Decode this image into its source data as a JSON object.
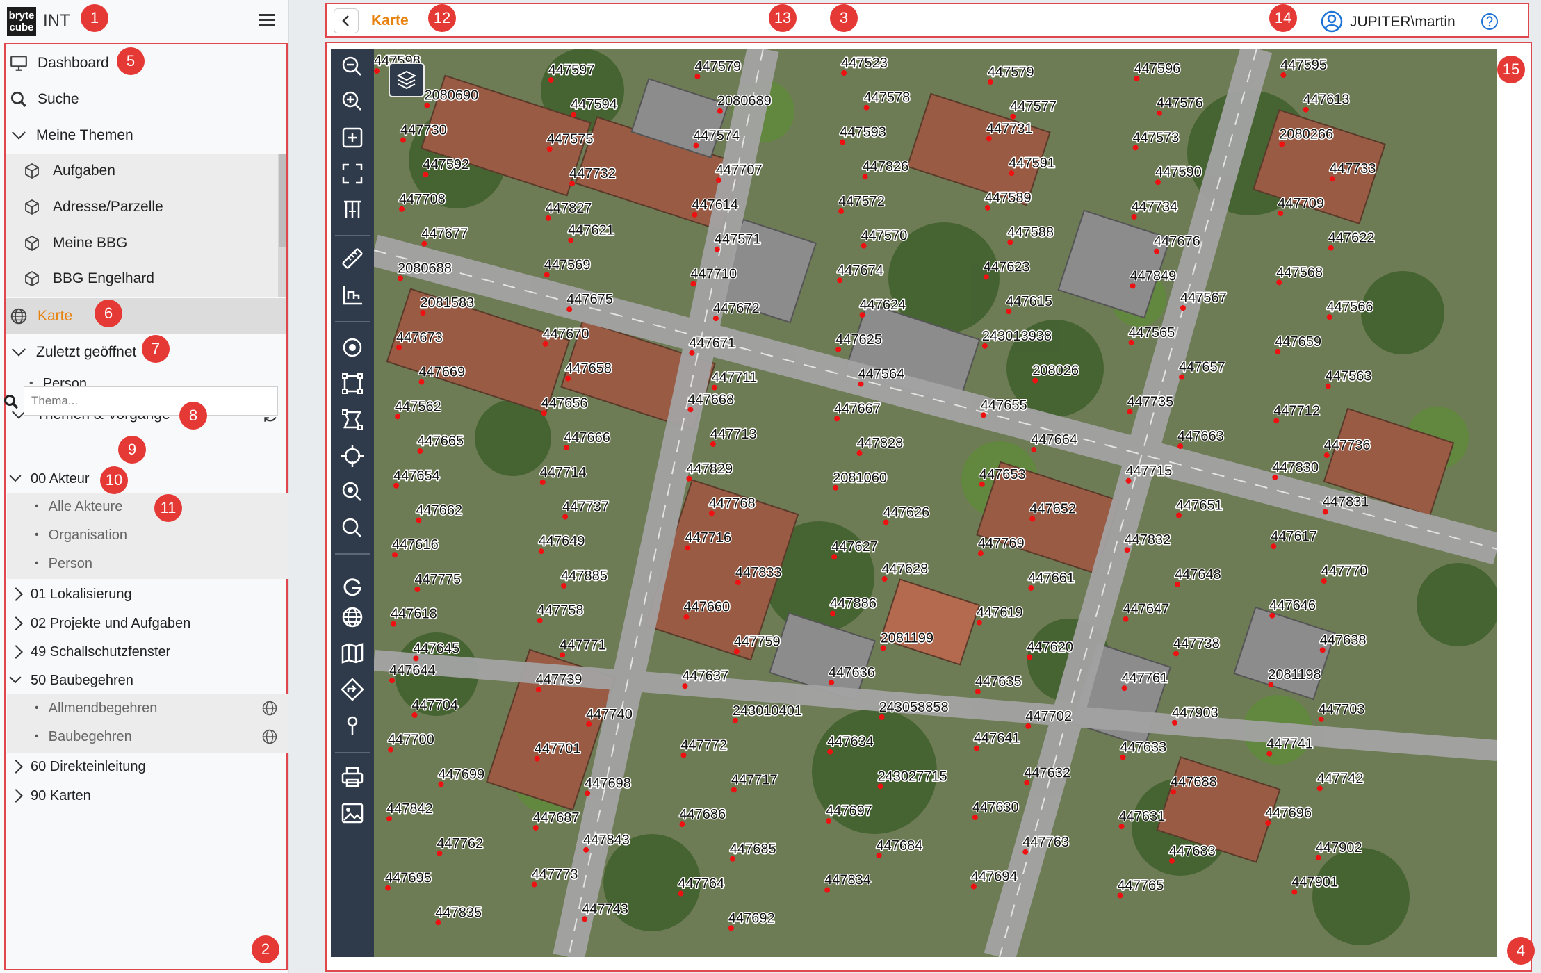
{
  "app": {
    "name": "INT",
    "logo_text": [
      "bryte",
      "cube"
    ]
  },
  "sidebar": {
    "dashboard": "Dashboard",
    "search": "Suche",
    "my_themes": {
      "label": "Meine Themen",
      "items": [
        "Aufgaben",
        "Adresse/Parzelle",
        "Meine BBG",
        "BBG Engelhard"
      ]
    },
    "karte": "Karte",
    "recent": {
      "label": "Zuletzt geöffnet",
      "items": [
        "Person"
      ]
    },
    "themes": {
      "label": "Themen & Vorgänge",
      "search_placeholder": "Thema..."
    },
    "tree": {
      "akteur": {
        "label": "00 Akteur",
        "items": [
          "Alle Akteure",
          "Organisation",
          "Person"
        ]
      },
      "lokalisierung": "01 Lokalisierung",
      "projekte": "02 Projekte und Aufgaben",
      "schallschutz": "49 Schallschutzfenster",
      "baubegehren": {
        "label": "50 Baubegehren",
        "items": [
          "Allmendbegehren",
          "Baubegehren"
        ]
      },
      "direkt": "60 Direkteinleitung",
      "karten": "90 Karten"
    }
  },
  "header": {
    "title": "Karte",
    "user": "JUPITER\\martin"
  },
  "annotations": [
    "1",
    "2",
    "3",
    "4",
    "5",
    "6",
    "7",
    "8",
    "9",
    "10",
    "11",
    "12",
    "13",
    "14",
    "15"
  ],
  "toolbar_icons": [
    "zoom-out-icon",
    "zoom-in-icon",
    "add-icon",
    "fullscreen-icon",
    "measure-columns-icon",
    "ruler-icon",
    "area-measure-icon",
    "point-icon",
    "polygon-icon",
    "polygon-edit-icon",
    "locate-icon",
    "zoom-search-icon",
    "search-icon",
    "google-icon",
    "globe-icon",
    "map-icon",
    "route-icon",
    "pin-icon",
    "print-icon",
    "image-export-icon"
  ],
  "map_labels": [
    "447598",
    "447597",
    "447579",
    "447523",
    "447579",
    "447596",
    "447595",
    "2080690",
    "447594",
    "2080689",
    "447578",
    "447577",
    "447576",
    "447613",
    "447730",
    "447575",
    "447574",
    "447593",
    "447731",
    "447573",
    "2080266",
    "447592",
    "447732",
    "447707",
    "447826",
    "447591",
    "447590",
    "447733",
    "447708",
    "447827",
    "447614",
    "447572",
    "447589",
    "447734",
    "447709",
    "447677",
    "447621",
    "447571",
    "447570",
    "447588",
    "447676",
    "447622",
    "2080688",
    "447569",
    "447710",
    "447674",
    "447623",
    "447849",
    "447568",
    "2081583",
    "447675",
    "447672",
    "447624",
    "447615",
    "447567",
    "447566",
    "447673",
    "447670",
    "447671",
    "447625",
    "243013938",
    "447565",
    "447659",
    "447669",
    "447658",
    "447711",
    "447564",
    "208026",
    "447657",
    "447563",
    "447562",
    "447656",
    "447668",
    "447667",
    "447655",
    "447735",
    "447712",
    "447665",
    "447666",
    "447713",
    "447828",
    "447664",
    "447663",
    "447736",
    "447654",
    "447714",
    "447829",
    "2081060",
    "447653",
    "447715",
    "447830",
    "447662",
    "447737",
    "447768",
    "447626",
    "447652",
    "447651",
    "447831",
    "447616",
    "447649",
    "447716",
    "447627",
    "447769",
    "447832",
    "447617",
    "447775",
    "447885",
    "447833",
    "447628",
    "447661",
    "447648",
    "447770",
    "447618",
    "447758",
    "447660",
    "447886",
    "447619",
    "447647",
    "447646",
    "447645",
    "447771",
    "447759",
    "2081199",
    "447620",
    "447738",
    "447638",
    "447644",
    "447739",
    "447637",
    "447636",
    "447635",
    "447761",
    "2081198",
    "447704",
    "447740",
    "243010401",
    "243058858",
    "447702",
    "447903",
    "447703",
    "447700",
    "447701",
    "447772",
    "447634",
    "447641",
    "447633",
    "447741",
    "447699",
    "447698",
    "447717",
    "243027715",
    "447632",
    "447688",
    "447742",
    "447842",
    "447687",
    "447686",
    "447697",
    "447630",
    "447631",
    "447696",
    "447762",
    "447843",
    "447685",
    "447684",
    "447763",
    "447683",
    "447902",
    "447695",
    "447773",
    "447764",
    "447834",
    "447694",
    "447765",
    "447901",
    "447835",
    "447743",
    "447692"
  ]
}
